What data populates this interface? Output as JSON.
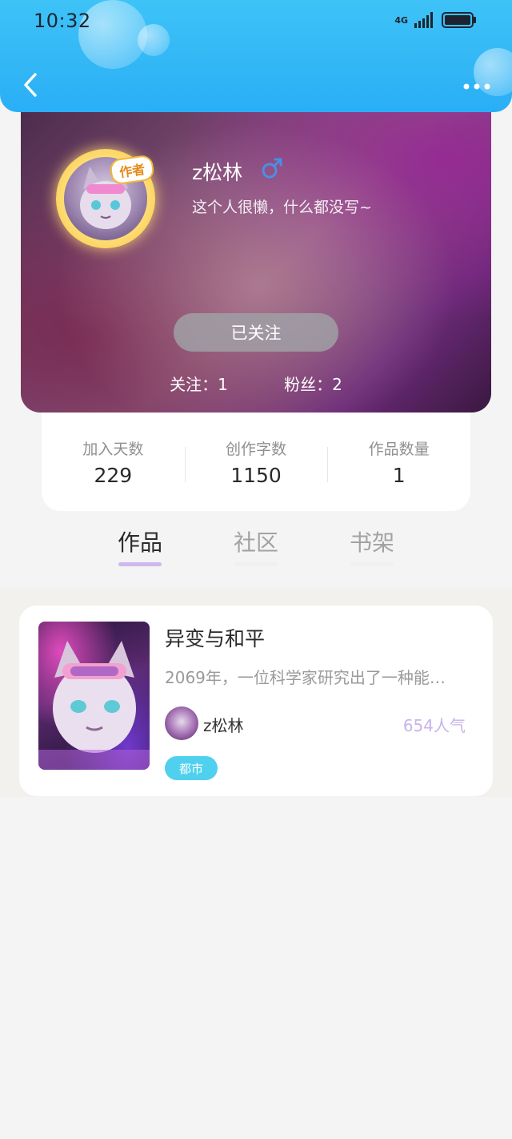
{
  "status_bar": {
    "time": "10:32",
    "network": "4G"
  },
  "profile": {
    "username": "z松林",
    "gender_icon": "male-icon",
    "bio": "这个人很懒，什么都没写~",
    "author_badge": "作者",
    "follow_button": "已关注",
    "following_text": "关注：1",
    "followers_text": "粉丝：2"
  },
  "stats": [
    {
      "label": "加入天数",
      "value": "229"
    },
    {
      "label": "创作字数",
      "value": "1150"
    },
    {
      "label": "作品数量",
      "value": "1"
    }
  ],
  "tabs": [
    {
      "label": "作品",
      "active": true
    },
    {
      "label": "社区",
      "active": false
    },
    {
      "label": "书架",
      "active": false
    }
  ],
  "works": [
    {
      "title": "异变与和平",
      "description": "2069年，一位科学家研究出了一种能…",
      "author": "z松林",
      "popularity": "654人气",
      "genre": "都市"
    }
  ],
  "colors": {
    "header": "#2aaef6",
    "tab_active_underline": "#cfb6ec",
    "genre_tag": "#4fd0ee",
    "popularity": "#c8b3ea"
  }
}
